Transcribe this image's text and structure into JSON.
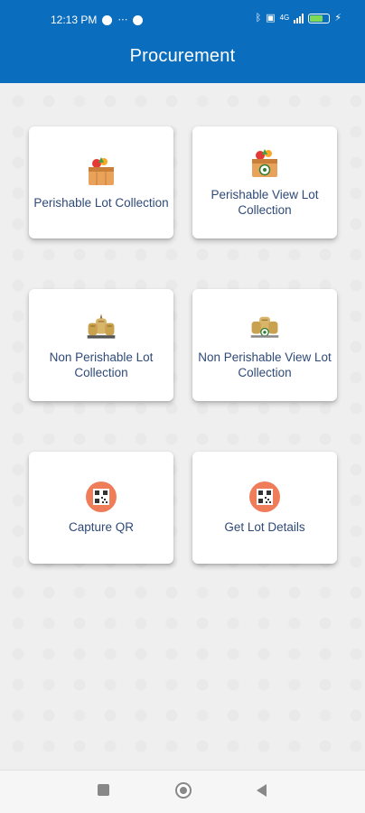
{
  "status_bar": {
    "time": "12:13 PM",
    "network_label": "4G"
  },
  "header": {
    "title": "Procurement"
  },
  "cards": [
    {
      "label": "Perishable Lot Collection",
      "icon": "vegetable-basket-icon"
    },
    {
      "label": "Perishable View Lot Collection",
      "icon": "vegetable-basket-view-icon"
    },
    {
      "label": "Non Perishable Lot Collection",
      "icon": "grain-sacks-icon"
    },
    {
      "label": "Non Perishable View Lot Collection",
      "icon": "grain-sacks-view-icon"
    },
    {
      "label": "Capture QR",
      "icon": "qr-code-icon"
    },
    {
      "label": "Get Lot Details",
      "icon": "qr-code-icon"
    }
  ],
  "colors": {
    "header_bg": "#0b6dbd",
    "card_text": "#2f4a78",
    "qr_badge": "#ef7d5a",
    "battery": "#7ed957"
  },
  "battery_level": 0.7
}
